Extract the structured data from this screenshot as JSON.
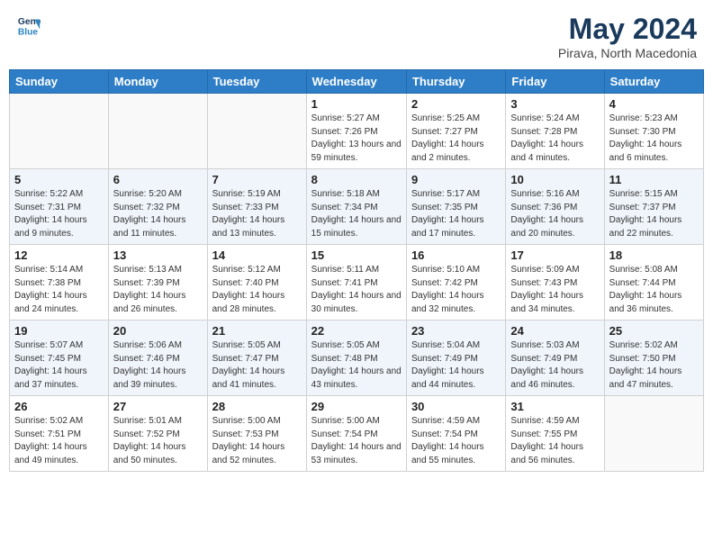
{
  "header": {
    "logo_line1": "General",
    "logo_line2": "Blue",
    "month_year": "May 2024",
    "location": "Pirava, North Macedonia"
  },
  "weekdays": [
    "Sunday",
    "Monday",
    "Tuesday",
    "Wednesday",
    "Thursday",
    "Friday",
    "Saturday"
  ],
  "weeks": [
    [
      {
        "day": "",
        "sunrise": "",
        "sunset": "",
        "daylight": ""
      },
      {
        "day": "",
        "sunrise": "",
        "sunset": "",
        "daylight": ""
      },
      {
        "day": "",
        "sunrise": "",
        "sunset": "",
        "daylight": ""
      },
      {
        "day": "1",
        "sunrise": "Sunrise: 5:27 AM",
        "sunset": "Sunset: 7:26 PM",
        "daylight": "Daylight: 13 hours and 59 minutes."
      },
      {
        "day": "2",
        "sunrise": "Sunrise: 5:25 AM",
        "sunset": "Sunset: 7:27 PM",
        "daylight": "Daylight: 14 hours and 2 minutes."
      },
      {
        "day": "3",
        "sunrise": "Sunrise: 5:24 AM",
        "sunset": "Sunset: 7:28 PM",
        "daylight": "Daylight: 14 hours and 4 minutes."
      },
      {
        "day": "4",
        "sunrise": "Sunrise: 5:23 AM",
        "sunset": "Sunset: 7:30 PM",
        "daylight": "Daylight: 14 hours and 6 minutes."
      }
    ],
    [
      {
        "day": "5",
        "sunrise": "Sunrise: 5:22 AM",
        "sunset": "Sunset: 7:31 PM",
        "daylight": "Daylight: 14 hours and 9 minutes."
      },
      {
        "day": "6",
        "sunrise": "Sunrise: 5:20 AM",
        "sunset": "Sunset: 7:32 PM",
        "daylight": "Daylight: 14 hours and 11 minutes."
      },
      {
        "day": "7",
        "sunrise": "Sunrise: 5:19 AM",
        "sunset": "Sunset: 7:33 PM",
        "daylight": "Daylight: 14 hours and 13 minutes."
      },
      {
        "day": "8",
        "sunrise": "Sunrise: 5:18 AM",
        "sunset": "Sunset: 7:34 PM",
        "daylight": "Daylight: 14 hours and 15 minutes."
      },
      {
        "day": "9",
        "sunrise": "Sunrise: 5:17 AM",
        "sunset": "Sunset: 7:35 PM",
        "daylight": "Daylight: 14 hours and 17 minutes."
      },
      {
        "day": "10",
        "sunrise": "Sunrise: 5:16 AM",
        "sunset": "Sunset: 7:36 PM",
        "daylight": "Daylight: 14 hours and 20 minutes."
      },
      {
        "day": "11",
        "sunrise": "Sunrise: 5:15 AM",
        "sunset": "Sunset: 7:37 PM",
        "daylight": "Daylight: 14 hours and 22 minutes."
      }
    ],
    [
      {
        "day": "12",
        "sunrise": "Sunrise: 5:14 AM",
        "sunset": "Sunset: 7:38 PM",
        "daylight": "Daylight: 14 hours and 24 minutes."
      },
      {
        "day": "13",
        "sunrise": "Sunrise: 5:13 AM",
        "sunset": "Sunset: 7:39 PM",
        "daylight": "Daylight: 14 hours and 26 minutes."
      },
      {
        "day": "14",
        "sunrise": "Sunrise: 5:12 AM",
        "sunset": "Sunset: 7:40 PM",
        "daylight": "Daylight: 14 hours and 28 minutes."
      },
      {
        "day": "15",
        "sunrise": "Sunrise: 5:11 AM",
        "sunset": "Sunset: 7:41 PM",
        "daylight": "Daylight: 14 hours and 30 minutes."
      },
      {
        "day": "16",
        "sunrise": "Sunrise: 5:10 AM",
        "sunset": "Sunset: 7:42 PM",
        "daylight": "Daylight: 14 hours and 32 minutes."
      },
      {
        "day": "17",
        "sunrise": "Sunrise: 5:09 AM",
        "sunset": "Sunset: 7:43 PM",
        "daylight": "Daylight: 14 hours and 34 minutes."
      },
      {
        "day": "18",
        "sunrise": "Sunrise: 5:08 AM",
        "sunset": "Sunset: 7:44 PM",
        "daylight": "Daylight: 14 hours and 36 minutes."
      }
    ],
    [
      {
        "day": "19",
        "sunrise": "Sunrise: 5:07 AM",
        "sunset": "Sunset: 7:45 PM",
        "daylight": "Daylight: 14 hours and 37 minutes."
      },
      {
        "day": "20",
        "sunrise": "Sunrise: 5:06 AM",
        "sunset": "Sunset: 7:46 PM",
        "daylight": "Daylight: 14 hours and 39 minutes."
      },
      {
        "day": "21",
        "sunrise": "Sunrise: 5:05 AM",
        "sunset": "Sunset: 7:47 PM",
        "daylight": "Daylight: 14 hours and 41 minutes."
      },
      {
        "day": "22",
        "sunrise": "Sunrise: 5:05 AM",
        "sunset": "Sunset: 7:48 PM",
        "daylight": "Daylight: 14 hours and 43 minutes."
      },
      {
        "day": "23",
        "sunrise": "Sunrise: 5:04 AM",
        "sunset": "Sunset: 7:49 PM",
        "daylight": "Daylight: 14 hours and 44 minutes."
      },
      {
        "day": "24",
        "sunrise": "Sunrise: 5:03 AM",
        "sunset": "Sunset: 7:49 PM",
        "daylight": "Daylight: 14 hours and 46 minutes."
      },
      {
        "day": "25",
        "sunrise": "Sunrise: 5:02 AM",
        "sunset": "Sunset: 7:50 PM",
        "daylight": "Daylight: 14 hours and 47 minutes."
      }
    ],
    [
      {
        "day": "26",
        "sunrise": "Sunrise: 5:02 AM",
        "sunset": "Sunset: 7:51 PM",
        "daylight": "Daylight: 14 hours and 49 minutes."
      },
      {
        "day": "27",
        "sunrise": "Sunrise: 5:01 AM",
        "sunset": "Sunset: 7:52 PM",
        "daylight": "Daylight: 14 hours and 50 minutes."
      },
      {
        "day": "28",
        "sunrise": "Sunrise: 5:00 AM",
        "sunset": "Sunset: 7:53 PM",
        "daylight": "Daylight: 14 hours and 52 minutes."
      },
      {
        "day": "29",
        "sunrise": "Sunrise: 5:00 AM",
        "sunset": "Sunset: 7:54 PM",
        "daylight": "Daylight: 14 hours and 53 minutes."
      },
      {
        "day": "30",
        "sunrise": "Sunrise: 4:59 AM",
        "sunset": "Sunset: 7:54 PM",
        "daylight": "Daylight: 14 hours and 55 minutes."
      },
      {
        "day": "31",
        "sunrise": "Sunrise: 4:59 AM",
        "sunset": "Sunset: 7:55 PM",
        "daylight": "Daylight: 14 hours and 56 minutes."
      },
      {
        "day": "",
        "sunrise": "",
        "sunset": "",
        "daylight": ""
      }
    ]
  ]
}
